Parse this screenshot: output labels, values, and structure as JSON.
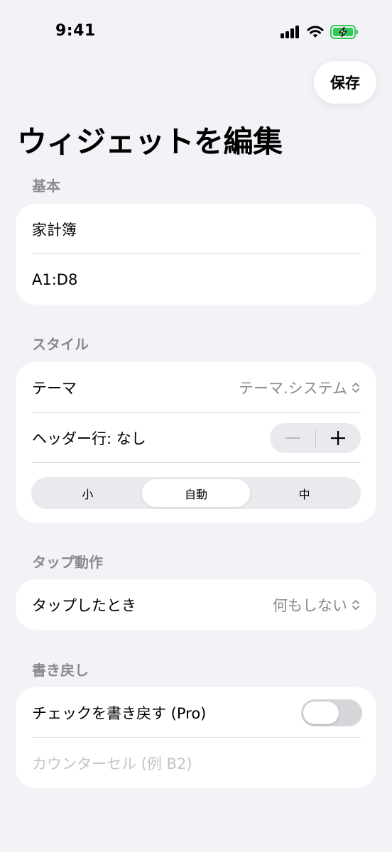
{
  "status_bar": {
    "time": "9:41"
  },
  "toolbar": {
    "save_label": "保存"
  },
  "title": "ウィジェットを編集",
  "sections": {
    "basic": {
      "header": "基本",
      "name_value": "家計簿",
      "range_value": "A1:D8"
    },
    "style": {
      "header": "スタイル",
      "theme_label": "テーマ",
      "theme_value": "テーマ.システム",
      "header_row_label": "ヘッダー行: なし",
      "size_options": [
        "小",
        "自動",
        "中"
      ],
      "size_selected": "自動"
    },
    "tap_action": {
      "header": "タップ動作",
      "on_tap_label": "タップしたとき",
      "on_tap_value": "何もしない"
    },
    "write_back": {
      "header": "書き戻し",
      "checkbox_label": "チェックを書き戻す (Pro)",
      "toggle_on": false,
      "counter_placeholder": "カウンターセル (例 B2)"
    }
  },
  "colors": {
    "background": "#f2f2f7",
    "card": "#ffffff",
    "secondary_text": "#8a8a8e",
    "battery_green": "#34c759"
  }
}
